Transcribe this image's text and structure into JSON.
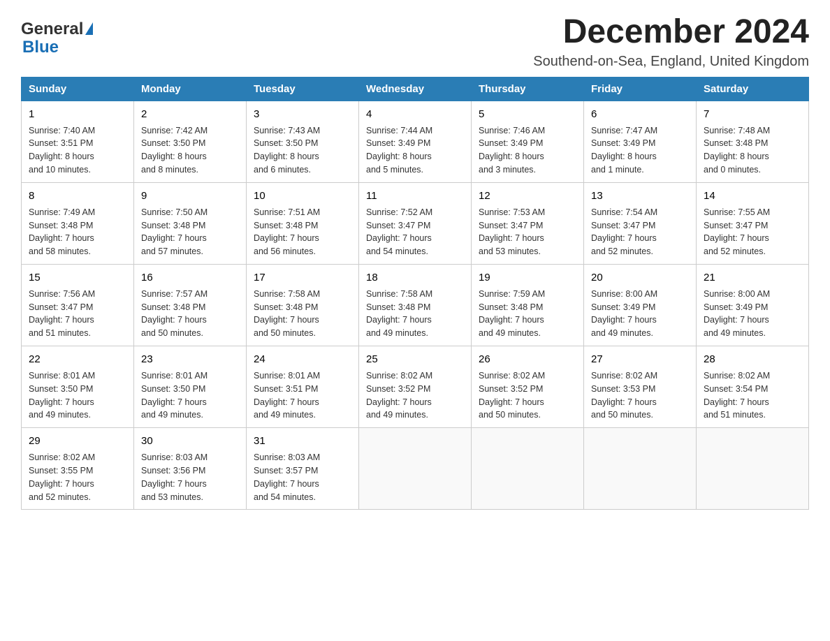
{
  "logo": {
    "text_general": "General",
    "text_blue": "Blue",
    "triangle_label": "logo-triangle"
  },
  "title": {
    "month_year": "December 2024",
    "location": "Southend-on-Sea, England, United Kingdom"
  },
  "headers": [
    "Sunday",
    "Monday",
    "Tuesday",
    "Wednesday",
    "Thursday",
    "Friday",
    "Saturday"
  ],
  "weeks": [
    [
      {
        "day": "1",
        "sunrise": "Sunrise: 7:40 AM",
        "sunset": "Sunset: 3:51 PM",
        "daylight": "Daylight: 8 hours",
        "daylight2": "and 10 minutes."
      },
      {
        "day": "2",
        "sunrise": "Sunrise: 7:42 AM",
        "sunset": "Sunset: 3:50 PM",
        "daylight": "Daylight: 8 hours",
        "daylight2": "and 8 minutes."
      },
      {
        "day": "3",
        "sunrise": "Sunrise: 7:43 AM",
        "sunset": "Sunset: 3:50 PM",
        "daylight": "Daylight: 8 hours",
        "daylight2": "and 6 minutes."
      },
      {
        "day": "4",
        "sunrise": "Sunrise: 7:44 AM",
        "sunset": "Sunset: 3:49 PM",
        "daylight": "Daylight: 8 hours",
        "daylight2": "and 5 minutes."
      },
      {
        "day": "5",
        "sunrise": "Sunrise: 7:46 AM",
        "sunset": "Sunset: 3:49 PM",
        "daylight": "Daylight: 8 hours",
        "daylight2": "and 3 minutes."
      },
      {
        "day": "6",
        "sunrise": "Sunrise: 7:47 AM",
        "sunset": "Sunset: 3:49 PM",
        "daylight": "Daylight: 8 hours",
        "daylight2": "and 1 minute."
      },
      {
        "day": "7",
        "sunrise": "Sunrise: 7:48 AM",
        "sunset": "Sunset: 3:48 PM",
        "daylight": "Daylight: 8 hours",
        "daylight2": "and 0 minutes."
      }
    ],
    [
      {
        "day": "8",
        "sunrise": "Sunrise: 7:49 AM",
        "sunset": "Sunset: 3:48 PM",
        "daylight": "Daylight: 7 hours",
        "daylight2": "and 58 minutes."
      },
      {
        "day": "9",
        "sunrise": "Sunrise: 7:50 AM",
        "sunset": "Sunset: 3:48 PM",
        "daylight": "Daylight: 7 hours",
        "daylight2": "and 57 minutes."
      },
      {
        "day": "10",
        "sunrise": "Sunrise: 7:51 AM",
        "sunset": "Sunset: 3:48 PM",
        "daylight": "Daylight: 7 hours",
        "daylight2": "and 56 minutes."
      },
      {
        "day": "11",
        "sunrise": "Sunrise: 7:52 AM",
        "sunset": "Sunset: 3:47 PM",
        "daylight": "Daylight: 7 hours",
        "daylight2": "and 54 minutes."
      },
      {
        "day": "12",
        "sunrise": "Sunrise: 7:53 AM",
        "sunset": "Sunset: 3:47 PM",
        "daylight": "Daylight: 7 hours",
        "daylight2": "and 53 minutes."
      },
      {
        "day": "13",
        "sunrise": "Sunrise: 7:54 AM",
        "sunset": "Sunset: 3:47 PM",
        "daylight": "Daylight: 7 hours",
        "daylight2": "and 52 minutes."
      },
      {
        "day": "14",
        "sunrise": "Sunrise: 7:55 AM",
        "sunset": "Sunset: 3:47 PM",
        "daylight": "Daylight: 7 hours",
        "daylight2": "and 52 minutes."
      }
    ],
    [
      {
        "day": "15",
        "sunrise": "Sunrise: 7:56 AM",
        "sunset": "Sunset: 3:47 PM",
        "daylight": "Daylight: 7 hours",
        "daylight2": "and 51 minutes."
      },
      {
        "day": "16",
        "sunrise": "Sunrise: 7:57 AM",
        "sunset": "Sunset: 3:48 PM",
        "daylight": "Daylight: 7 hours",
        "daylight2": "and 50 minutes."
      },
      {
        "day": "17",
        "sunrise": "Sunrise: 7:58 AM",
        "sunset": "Sunset: 3:48 PM",
        "daylight": "Daylight: 7 hours",
        "daylight2": "and 50 minutes."
      },
      {
        "day": "18",
        "sunrise": "Sunrise: 7:58 AM",
        "sunset": "Sunset: 3:48 PM",
        "daylight": "Daylight: 7 hours",
        "daylight2": "and 49 minutes."
      },
      {
        "day": "19",
        "sunrise": "Sunrise: 7:59 AM",
        "sunset": "Sunset: 3:48 PM",
        "daylight": "Daylight: 7 hours",
        "daylight2": "and 49 minutes."
      },
      {
        "day": "20",
        "sunrise": "Sunrise: 8:00 AM",
        "sunset": "Sunset: 3:49 PM",
        "daylight": "Daylight: 7 hours",
        "daylight2": "and 49 minutes."
      },
      {
        "day": "21",
        "sunrise": "Sunrise: 8:00 AM",
        "sunset": "Sunset: 3:49 PM",
        "daylight": "Daylight: 7 hours",
        "daylight2": "and 49 minutes."
      }
    ],
    [
      {
        "day": "22",
        "sunrise": "Sunrise: 8:01 AM",
        "sunset": "Sunset: 3:50 PM",
        "daylight": "Daylight: 7 hours",
        "daylight2": "and 49 minutes."
      },
      {
        "day": "23",
        "sunrise": "Sunrise: 8:01 AM",
        "sunset": "Sunset: 3:50 PM",
        "daylight": "Daylight: 7 hours",
        "daylight2": "and 49 minutes."
      },
      {
        "day": "24",
        "sunrise": "Sunrise: 8:01 AM",
        "sunset": "Sunset: 3:51 PM",
        "daylight": "Daylight: 7 hours",
        "daylight2": "and 49 minutes."
      },
      {
        "day": "25",
        "sunrise": "Sunrise: 8:02 AM",
        "sunset": "Sunset: 3:52 PM",
        "daylight": "Daylight: 7 hours",
        "daylight2": "and 49 minutes."
      },
      {
        "day": "26",
        "sunrise": "Sunrise: 8:02 AM",
        "sunset": "Sunset: 3:52 PM",
        "daylight": "Daylight: 7 hours",
        "daylight2": "and 50 minutes."
      },
      {
        "day": "27",
        "sunrise": "Sunrise: 8:02 AM",
        "sunset": "Sunset: 3:53 PM",
        "daylight": "Daylight: 7 hours",
        "daylight2": "and 50 minutes."
      },
      {
        "day": "28",
        "sunrise": "Sunrise: 8:02 AM",
        "sunset": "Sunset: 3:54 PM",
        "daylight": "Daylight: 7 hours",
        "daylight2": "and 51 minutes."
      }
    ],
    [
      {
        "day": "29",
        "sunrise": "Sunrise: 8:02 AM",
        "sunset": "Sunset: 3:55 PM",
        "daylight": "Daylight: 7 hours",
        "daylight2": "and 52 minutes."
      },
      {
        "day": "30",
        "sunrise": "Sunrise: 8:03 AM",
        "sunset": "Sunset: 3:56 PM",
        "daylight": "Daylight: 7 hours",
        "daylight2": "and 53 minutes."
      },
      {
        "day": "31",
        "sunrise": "Sunrise: 8:03 AM",
        "sunset": "Sunset: 3:57 PM",
        "daylight": "Daylight: 7 hours",
        "daylight2": "and 54 minutes."
      },
      null,
      null,
      null,
      null
    ]
  ]
}
